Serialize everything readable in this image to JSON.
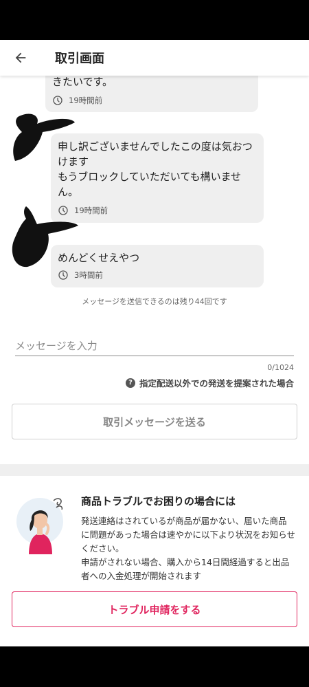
{
  "header": {
    "title": "取引画面",
    "back_icon": "arrow-left-icon"
  },
  "messages": [
    {
      "text": "きたいです。",
      "time": "19時間前"
    },
    {
      "text": "申し訳ございませんでしたこの度は気おつけます\nもうブロックしていただいても構いません。",
      "time": "19時間前"
    },
    {
      "text": "めんどくせえやつ",
      "time": "3時間前"
    }
  ],
  "remaining_text": "メッセージを送信できるのは残り44回です",
  "composer": {
    "placeholder": "メッセージを入力",
    "value": "",
    "counter": "0/1024",
    "help_link": "指定配送以外での発送を提案された場合",
    "send_label": "取引メッセージを送る"
  },
  "trouble": {
    "title": "商品トラブルでお困りの場合には",
    "body": "発送連絡はされているが商品が届かない、届いた商品に問題があった場合は速やかに以下より状況をお知らせください。\n申請がされない場合、購入から14日間経過すると出品者への入金処理が開始されます",
    "button_label": "トラブル申請をする"
  },
  "colors": {
    "accent": "#e0245e",
    "bubble": "#efefef",
    "band": "#efefef"
  }
}
